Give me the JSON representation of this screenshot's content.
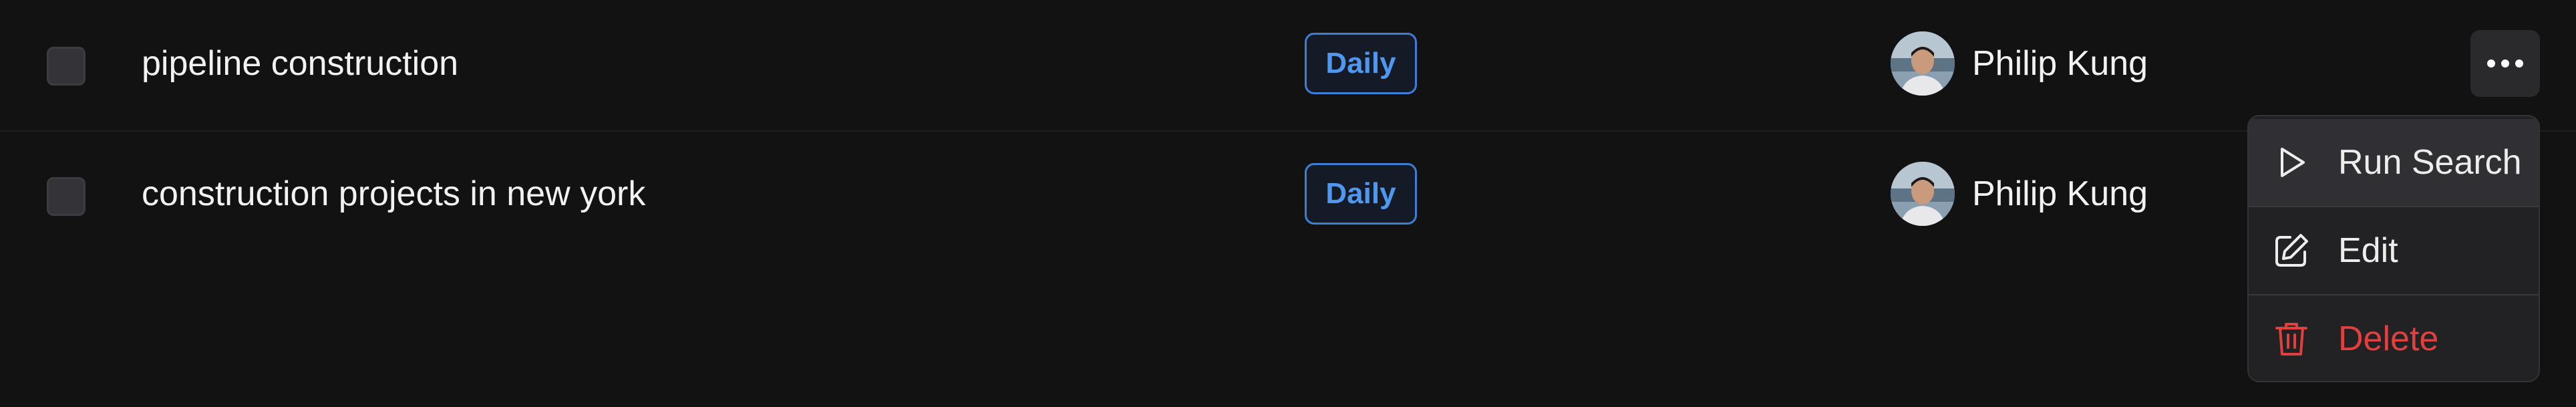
{
  "rows": [
    {
      "name": "pipeline construction",
      "frequency": "Daily",
      "owner": "Philip Kung"
    },
    {
      "name": "construction projects in new york",
      "frequency": "Daily",
      "owner": "Philip Kung"
    }
  ],
  "menu": {
    "items": [
      {
        "label": "Run Search",
        "icon": "play-icon"
      },
      {
        "label": "Edit",
        "icon": "edit-icon"
      },
      {
        "label": "Delete",
        "icon": "trash-icon"
      }
    ]
  },
  "colors": {
    "background": "#121212",
    "badge": "#4f97ef",
    "danger": "#e0413f",
    "menu_background": "#222225"
  }
}
